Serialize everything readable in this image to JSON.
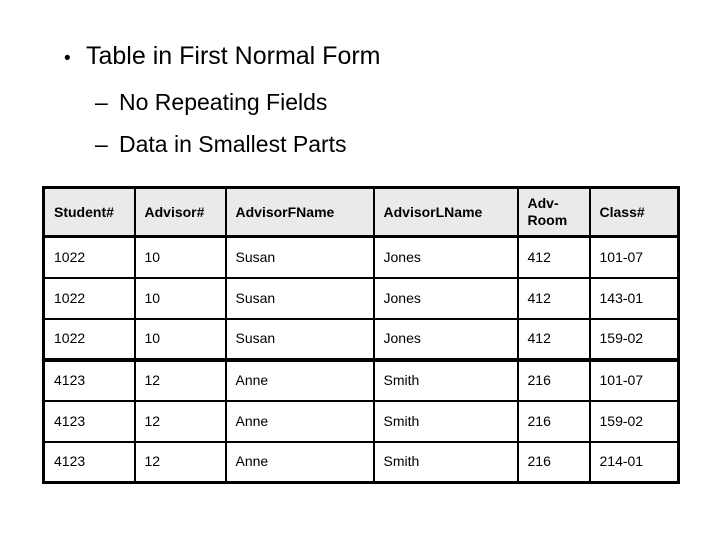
{
  "slide": {
    "background_color": "#FFFFFF",
    "text_color": "#000000",
    "bullets": [
      {
        "level": 1,
        "marker": "•",
        "text": "Table in First Normal Form"
      },
      {
        "level": 2,
        "marker": "–",
        "text": "No Repeating Fields"
      },
      {
        "level": 2,
        "marker": "–",
        "text": "Data in Smallest Parts"
      }
    ]
  },
  "table": {
    "header_background": "#EAEAEA",
    "border_color": "#000000",
    "columns": [
      "Student#",
      "Advisor#",
      "AdvisorFName",
      "AdvisorLName",
      "Adv-Room",
      "Class#"
    ],
    "rows": [
      {
        "cells": [
          "1022",
          "10",
          "Susan",
          "Jones",
          "412",
          "101-07"
        ],
        "group_end": false
      },
      {
        "cells": [
          "1022",
          "10",
          "Susan",
          "Jones",
          "412",
          "143-01"
        ],
        "group_end": false
      },
      {
        "cells": [
          "1022",
          "10",
          "Susan",
          "Jones",
          "412",
          "159-02"
        ],
        "group_end": true
      },
      {
        "cells": [
          "4123",
          "12",
          "Anne",
          "Smith",
          "216",
          "101-07"
        ],
        "group_end": false
      },
      {
        "cells": [
          "4123",
          "12",
          "Anne",
          "Smith",
          "216",
          "159-02"
        ],
        "group_end": false
      },
      {
        "cells": [
          "4123",
          "12",
          "Anne",
          "Smith",
          "216",
          "214-01"
        ],
        "group_end": false
      }
    ]
  }
}
